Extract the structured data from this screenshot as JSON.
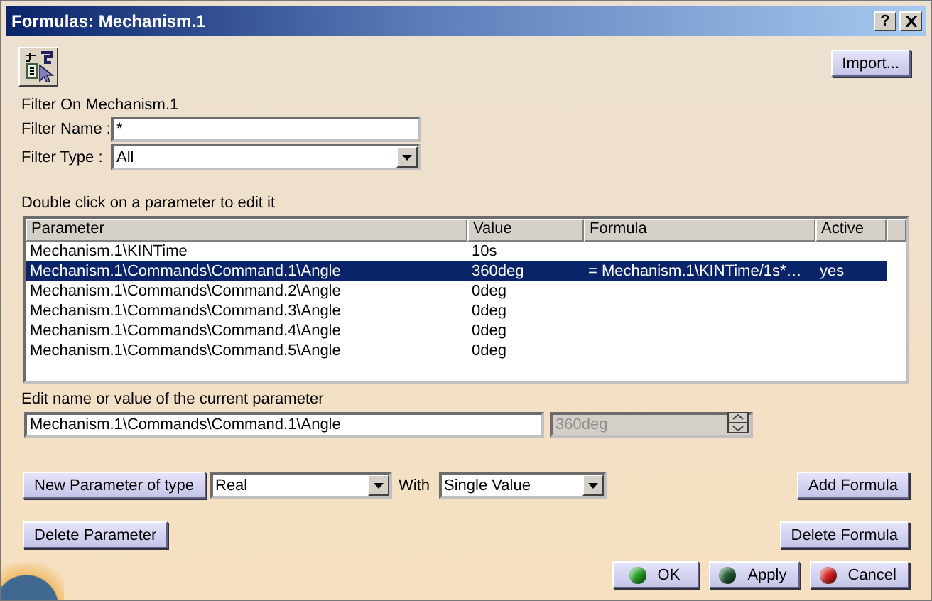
{
  "window": {
    "title": "Formulas: Mechanism.1",
    "help_button": "?"
  },
  "import_button": "Import...",
  "filter": {
    "heading": "Filter On Mechanism.1",
    "name_label": "Filter Name :",
    "name_value": "*",
    "type_label": "Filter Type :",
    "type_value": "All"
  },
  "table": {
    "caption": "Double click on a parameter to edit it",
    "columns": [
      "Parameter",
      "Value",
      "Formula",
      "Active"
    ],
    "rows": [
      {
        "parameter": "Mechanism.1\\KINTime",
        "value": "10s",
        "selected": false
      },
      {
        "parameter": "Mechanism.1\\Commands\\Command.1\\Angle",
        "value": "360deg",
        "formula": "= Mechanism.1\\KINTime/1s*…",
        "active": "yes",
        "selected": true
      },
      {
        "parameter": "Mechanism.1\\Commands\\Command.2\\Angle",
        "value": "0deg",
        "selected": false
      },
      {
        "parameter": "Mechanism.1\\Commands\\Command.3\\Angle",
        "value": "0deg",
        "selected": false
      },
      {
        "parameter": "Mechanism.1\\Commands\\Command.4\\Angle",
        "value": "0deg",
        "selected": false
      },
      {
        "parameter": "Mechanism.1\\Commands\\Command.5\\Angle",
        "value": "0deg",
        "selected": false
      }
    ]
  },
  "editor": {
    "label": "Edit name or value of the current parameter",
    "name_value": "Mechanism.1\\Commands\\Command.1\\Angle",
    "value": "360deg",
    "value_disabled": true
  },
  "new_parameter": {
    "button": "New Parameter of type",
    "type_value": "Real",
    "with_label": "With",
    "with_value": "Single Value"
  },
  "add_formula_button": "Add Formula",
  "delete_parameter_button": "Delete Parameter",
  "delete_formula_button": "Delete Formula",
  "dialog_buttons": [
    {
      "label": "OK",
      "color": "#22a022"
    },
    {
      "label": "Apply",
      "color": "#1e5a32"
    },
    {
      "label": "Cancel",
      "color": "#d42020"
    }
  ]
}
